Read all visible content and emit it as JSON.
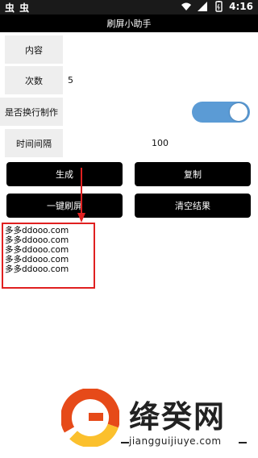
{
  "status_bar": {
    "left_icons": "虫 虫",
    "time": "4:16"
  },
  "app": {
    "title": "刷屏小助手"
  },
  "form": {
    "content": {
      "label": "内容",
      "value": ""
    },
    "count": {
      "label": "次数",
      "value": "5"
    },
    "newline": {
      "label": "是否换行制作",
      "toggle_on": true
    },
    "interval": {
      "label": "时间间隔",
      "value": "100"
    }
  },
  "buttons": {
    "generate": "生成",
    "copy": "复制",
    "one_click": "一键刷屏",
    "clear": "清空结果"
  },
  "result": {
    "lines": [
      "多多ddooo.com",
      "多多ddooo.com",
      "多多ddooo.com",
      "多多ddooo.com",
      "多多ddooo.com"
    ]
  },
  "watermark": {
    "name": "绛癸网",
    "url": "jiangguijiuye.com"
  },
  "colors": {
    "toggle": "#5b9bd5",
    "highlight": "#e02020",
    "button_bg": "#000000"
  }
}
